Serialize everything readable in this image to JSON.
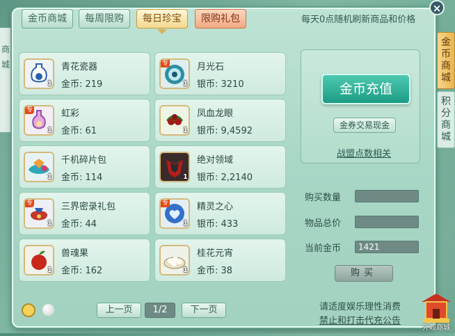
{
  "tabs": [
    {
      "label": "金币商城",
      "state": "normal"
    },
    {
      "label": "每周限购",
      "state": "normal"
    },
    {
      "label": "每日珍宝",
      "state": "active"
    },
    {
      "label": "限购礼包",
      "state": "gift"
    }
  ],
  "notice": "每天0点随机刷新商品和价格",
  "left_strip": "商城",
  "items": [
    {
      "name": "青花瓷器",
      "price": "金币: 219",
      "qty": "1",
      "tag": "",
      "icon": "blue-porcelain-vase-icon"
    },
    {
      "name": "月光石",
      "price": "银币: 3210",
      "qty": "1",
      "tag": "专",
      "icon": "moonstone-icon"
    },
    {
      "name": "虹彩",
      "price": "金币: 61",
      "qty": "1",
      "tag": "专",
      "icon": "iridescent-bottle-icon"
    },
    {
      "name": "凤血龙眼",
      "price": "银币: 9,4592",
      "qty": "1",
      "tag": "",
      "icon": "longan-fruit-icon"
    },
    {
      "name": "千机碎片包",
      "price": "金币: 114",
      "qty": "1",
      "tag": "",
      "icon": "fragment-pack-icon"
    },
    {
      "name": "绝对领域",
      "price": "银币: 2,2140",
      "qty": "1",
      "tag": "",
      "icon": "red-armor-icon"
    },
    {
      "name": "三界密录礼包",
      "price": "金币: 44",
      "qty": "1",
      "tag": "专",
      "icon": "treasure-bag-icon"
    },
    {
      "name": "精灵之心",
      "price": "银币: 433",
      "qty": "1",
      "tag": "专",
      "icon": "spirit-heart-icon"
    },
    {
      "name": "兽魂果",
      "price": "金币: 162",
      "qty": "1",
      "tag": "",
      "icon": "beast-soul-fruit-icon"
    },
    {
      "name": "桂花元宵",
      "price": "金币: 38",
      "qty": "1",
      "tag": "",
      "icon": "rice-ball-bowl-icon"
    }
  ],
  "right": {
    "recharge": "金币充值",
    "exchange": "金券交易现金",
    "alliance_link": "战盟点数相关",
    "buy_qty_label": "购买数量",
    "buy_qty_value": "",
    "total_label": "物品总价",
    "total_value": "",
    "gold_label": "当前金币",
    "gold_value": "1421",
    "buy_button": "购买"
  },
  "pager": {
    "prev": "上一页",
    "page": "1/2",
    "next": "下一页"
  },
  "footer": {
    "line1": "请适度娱乐理性消费",
    "line2": "禁止和打击代充公告"
  },
  "side_tabs": [
    {
      "label": "金币商城",
      "active": true
    },
    {
      "label": "积分商城",
      "active": false
    }
  ],
  "widget_label": "外观商城",
  "close_glyph": "×"
}
